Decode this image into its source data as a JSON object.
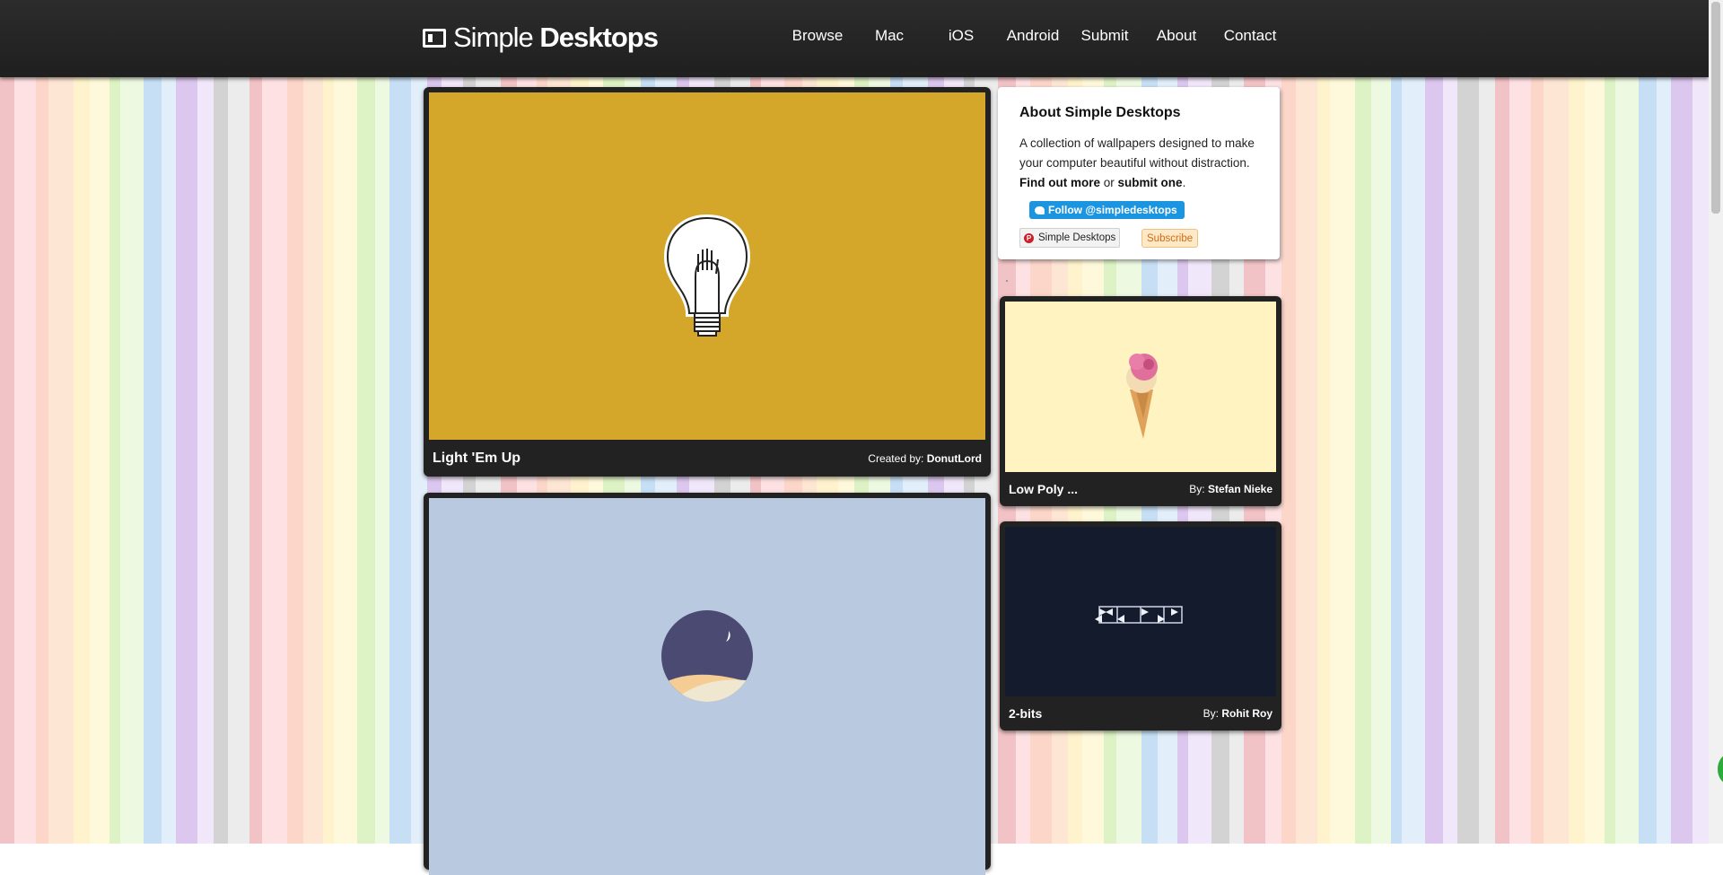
{
  "header": {
    "logo_light": "Simple",
    "logo_bold": "Desktops",
    "nav": [
      "Browse",
      "Mac",
      "iOS",
      "Android",
      "Submit",
      "About",
      "Contact"
    ]
  },
  "featured": [
    {
      "title": "Light 'Em Up",
      "credit_label": "Created by:",
      "author": "DonutLord",
      "bg": "#d4a62a"
    },
    {
      "title": "",
      "credit_label": "",
      "author": "",
      "bg": "#b8c9e0"
    }
  ],
  "about": {
    "heading": "About Simple Desktops",
    "text": "A collection of wallpapers designed to make your computer beautiful without distraction.",
    "link1": "Find out more",
    "or": "or",
    "link2": "submit one",
    "period": ".",
    "twitter": "Follow @simpledesktops",
    "pinterest": "Simple Desktops",
    "subscribe": "Subscribe"
  },
  "sidebar_items": [
    {
      "title": "Low Poly ...",
      "credit_label": "By:",
      "author": "Stefan Nieke",
      "bg": "#fff3c2"
    },
    {
      "title": "2-bits",
      "credit_label": "By:",
      "author": "Rohit Roy",
      "bg": "#141b2d"
    }
  ],
  "colors": {
    "header_bg": "#222222",
    "card_bg": "#222222",
    "twitter_blue": "#1b95e0",
    "subscribe_orange": "#d56a10"
  }
}
